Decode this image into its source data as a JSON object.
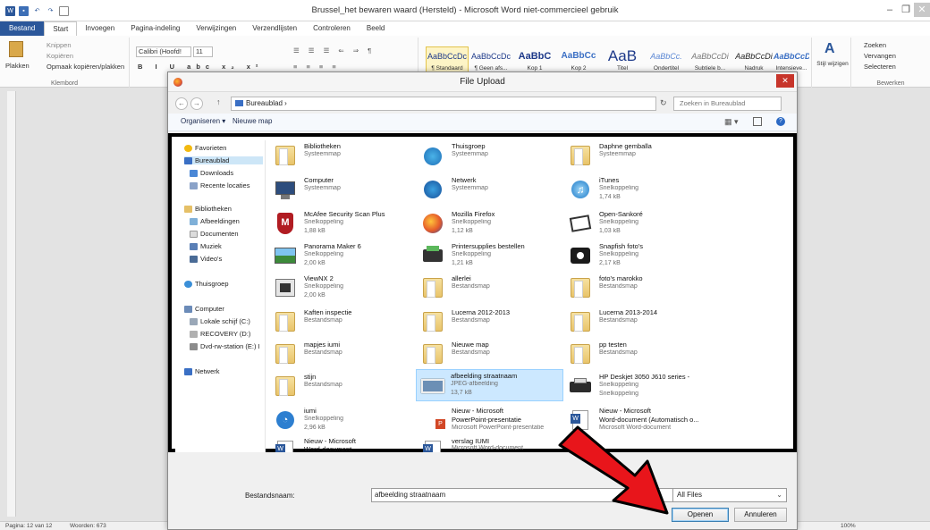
{
  "word": {
    "title": "Brussel_het bewaren waard (Hersteld) - Microsoft Word niet-commercieel gebruik",
    "tabs": [
      "Bestand",
      "Start",
      "Invoegen",
      "Pagina-indeling",
      "Verwijzingen",
      "Verzendlijsten",
      "Controleren",
      "Beeld"
    ],
    "clipboard": {
      "paste": "Plakken",
      "cut": "Knippen",
      "copy": "Kopiëren",
      "format_painter": "Opmaak kopiëren/plakken",
      "label": "Klembord"
    },
    "font": {
      "name": "Calibri (Hoofd!",
      "size": "11"
    },
    "styles": [
      {
        "sample": "AaBbCcDc",
        "name": "¶ Standaard"
      },
      {
        "sample": "AaBbCcDc",
        "name": "¶ Geen afs..."
      },
      {
        "sample": "AaBbC",
        "name": "Kop 1"
      },
      {
        "sample": "AaBbCc",
        "name": "Kop 2"
      },
      {
        "sample": "AaB",
        "name": "Titel"
      },
      {
        "sample": "AaBbCc.",
        "name": "Ondertitel"
      },
      {
        "sample": "AaBbCcDi",
        "name": "Subtiele b..."
      },
      {
        "sample": "AaBbCcDi",
        "name": "Nadruk"
      },
      {
        "sample": "AaBbCcDi",
        "name": "Intensieve..."
      }
    ],
    "change_styles": "Stijl wijzigen",
    "editing": {
      "find": "Zoeken",
      "replace": "Vervangen",
      "select": "Selecteren",
      "label": "Bewerken"
    },
    "status": {
      "page": "Pagina: 12 van 12",
      "words": "Woorden: 673",
      "zoom": "100%"
    }
  },
  "dialog": {
    "title": "File Upload",
    "address": "Bureaublad",
    "search_placeholder": "Zoeken in Bureaublad",
    "organize": "Organiseren",
    "new_folder": "Nieuwe map",
    "nav": {
      "favorites": "Favorieten",
      "desktop": "Bureaublad",
      "downloads": "Downloads",
      "recent": "Recente locaties",
      "libraries": "Bibliotheken",
      "pictures": "Afbeeldingen",
      "documents": "Documenten",
      "music": "Muziek",
      "videos": "Video's",
      "homegroup": "Thuisgroep",
      "computer": "Computer",
      "local_disk": "Lokale schijf (C:)",
      "recovery": "RECOVERY (D:)",
      "dvd": "Dvd-rw-station (E:) I",
      "network": "Netwerk"
    },
    "files": [
      {
        "name": "Bibliotheken",
        "type": "Systeemmap",
        "size": ""
      },
      {
        "name": "Thuisgroep",
        "type": "Systeemmap",
        "size": ""
      },
      {
        "name": "Daphne gemballa",
        "type": "Systeemmap",
        "size": ""
      },
      {
        "name": "Computer",
        "type": "Systeemmap",
        "size": ""
      },
      {
        "name": "Netwerk",
        "type": "Systeemmap",
        "size": ""
      },
      {
        "name": "iTunes",
        "type": "Snelkoppeling",
        "size": "1,74 kB"
      },
      {
        "name": "McAfee Security Scan Plus",
        "type": "Snelkoppeling",
        "size": "1,88 kB"
      },
      {
        "name": "Mozilla Firefox",
        "type": "Snelkoppeling",
        "size": "1,12 kB"
      },
      {
        "name": "Open-Sankoré",
        "type": "Snelkoppeling",
        "size": "1,03 kB"
      },
      {
        "name": "Panorama Maker 6",
        "type": "Snelkoppeling",
        "size": "2,00 kB"
      },
      {
        "name": "Printersupplies bestellen",
        "type": "Snelkoppeling",
        "size": "1,21 kB"
      },
      {
        "name": "Snapfish foto's",
        "type": "Snelkoppeling",
        "size": "2,17 kB"
      },
      {
        "name": "ViewNX 2",
        "type": "Snelkoppeling",
        "size": "2,00 kB"
      },
      {
        "name": "allerlei",
        "type": "Bestandsmap",
        "size": ""
      },
      {
        "name": "foto's marokko",
        "type": "Bestandsmap",
        "size": ""
      },
      {
        "name": "Kaften inspectie",
        "type": "Bestandsmap",
        "size": ""
      },
      {
        "name": "Lucerna 2012-2013",
        "type": "Bestandsmap",
        "size": ""
      },
      {
        "name": "Lucerna 2013-2014",
        "type": "Bestandsmap",
        "size": ""
      },
      {
        "name": "mapjes iumi",
        "type": "Bestandsmap",
        "size": ""
      },
      {
        "name": "Nieuwe map",
        "type": "Bestandsmap",
        "size": ""
      },
      {
        "name": "pp testen",
        "type": "Bestandsmap",
        "size": ""
      },
      {
        "name": "stijn",
        "type": "Bestandsmap",
        "size": ""
      },
      {
        "name": "afbeelding straatnaam",
        "type": "JPEG-afbeelding",
        "size": "13,7 kB"
      },
      {
        "name": "HP Deskjet 3050 J610 series -",
        "type": "Snelkoppeling",
        "size": "Snelkoppeling"
      },
      {
        "name": "iumi",
        "type": "Snelkoppeling",
        "size": "2,96 kB"
      },
      {
        "name": "Nieuw - Microsoft",
        "type": "PowerPoint-presentatie",
        "size": "Microsoft PowerPoint-presentatie"
      },
      {
        "name": "Nieuw - Microsoft",
        "type": "Word-document (Automatisch o...",
        "size": "Microsoft Word-document"
      },
      {
        "name": "Nieuw - Microsoft",
        "type": "Word-document",
        "size": ""
      },
      {
        "name": "verslag IUMI",
        "type": "Microsoft Word-document",
        "size": ""
      }
    ],
    "filename_label": "Bestandsnaam:",
    "filename_value": "afbeelding straatnaam",
    "filetype": "All Files",
    "open": "Openen",
    "cancel": "Annuleren"
  },
  "colors": {
    "accent": "#2b579a",
    "selection": "#cce8ff",
    "arrow": "#e8151b",
    "close": "#c7352b"
  }
}
